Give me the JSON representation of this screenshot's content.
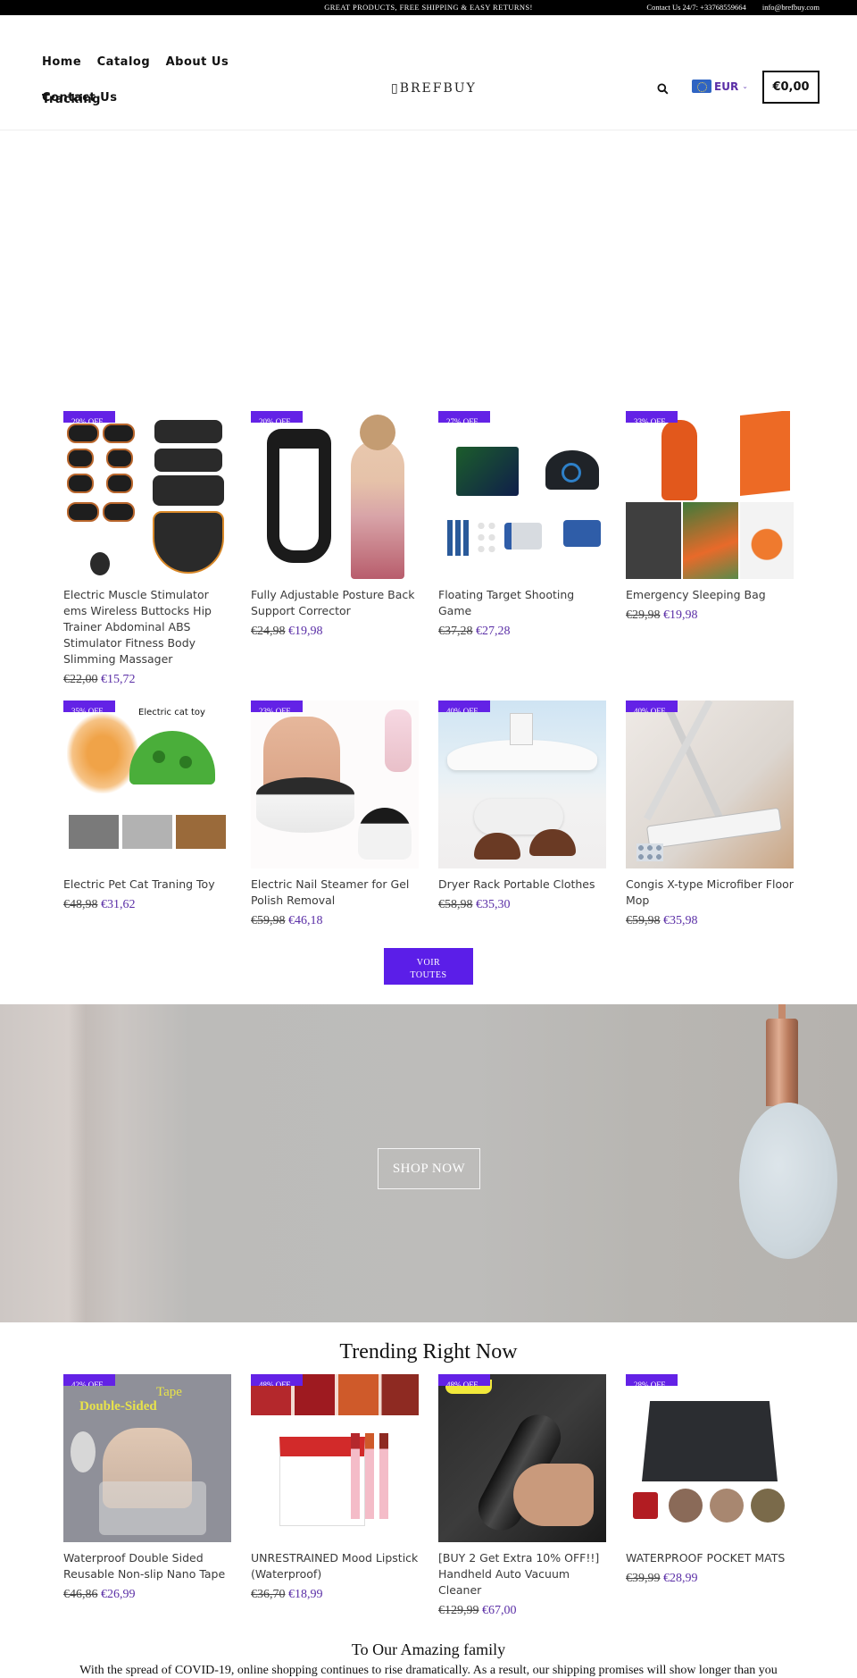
{
  "announcement": {
    "message": "GREAT PRODUCTS, FREE SHIPPING & EASY RETURNS!",
    "contact_phone": "Contact Us 24/7: +33768559664",
    "contact_email": "info@brefbuy.com"
  },
  "header": {
    "nav": [
      "Home",
      "Catalog",
      "About Us",
      "Contact Us",
      "Tracking"
    ],
    "logo": "▯BREFBUY",
    "currency": "EUR",
    "cart_total": "€0,00"
  },
  "featured": {
    "products": [
      {
        "badge": "29% OFF",
        "title": "Electric Muscle Stimulator ems Wireless Buttocks Hip Trainer Abdominal ABS Stimulator Fitness Body Slimming Massager",
        "old_price": "€22,00",
        "price": "€15,72",
        "image": "ems-muscle-stimulator"
      },
      {
        "badge": "20% OFF",
        "title": "Fully Adjustable Posture Back Support Corrector",
        "old_price": "€24,98",
        "price": "€19,98",
        "image": "posture-corrector"
      },
      {
        "badge": "27% OFF",
        "title": "Floating Target Shooting Game",
        "old_price": "€37,28",
        "price": "€27,28",
        "image": "floating-target-game"
      },
      {
        "badge": "33% OFF",
        "title": "Emergency Sleeping Bag",
        "old_price": "€29,98",
        "price": "€19,98",
        "image": "emergency-sleeping-bag"
      },
      {
        "badge": "35% OFF",
        "title": "Electric Pet Cat Traning Toy",
        "old_price": "€48,98",
        "price": "€31,62",
        "image": "electric-cat-toy",
        "image_caption": "Electric cat toy"
      },
      {
        "badge": "23% OFF",
        "title": "Electric Nail Steamer for Gel Polish Removal",
        "old_price": "€59,98",
        "price": "€46,18",
        "image": "nail-steamer"
      },
      {
        "badge": "40% OFF",
        "title": "Dryer Rack Portable Clothes",
        "old_price": "€58,98",
        "price": "€35,30",
        "image": "dryer-rack"
      },
      {
        "badge": "40% OFF",
        "title": "Congis X-type Microfiber Floor Mop",
        "old_price": "€59,98",
        "price": "€35,98",
        "image": "floor-mop"
      }
    ],
    "view_all_label": "VOIR TOUTES"
  },
  "hero": {
    "cta_label": "SHOP NOW"
  },
  "trending": {
    "title": "Trending Right Now",
    "products": [
      {
        "badge": "42% OFF",
        "title": "Waterproof Double Sided Reusable Non-slip Nano Tape",
        "old_price": "€46,86",
        "price": "€26,99",
        "image": "nano-tape",
        "image_caption_1": "Tape",
        "image_caption_2": "Double-Sided"
      },
      {
        "badge": "48% OFF",
        "title": "UNRESTRAINED Mood Lipstick (Waterproof)",
        "old_price": "€36,70",
        "price": "€18,99",
        "image": "mood-lipstick"
      },
      {
        "badge": "48% OFF",
        "title": "[BUY 2 Get Extra 10% OFF!!] Handheld Auto Vacuum Cleaner",
        "old_price": "€129,99",
        "price": "€67,00",
        "image": "handheld-vacuum"
      },
      {
        "badge": "28% OFF",
        "title": "WATERPROOF POCKET MATS",
        "old_price": "€39,99",
        "price": "€28,99",
        "image": "pocket-mat"
      }
    ]
  },
  "family": {
    "title": "To Our Amazing family",
    "text": "With the spread of COVID-19, online shopping continues to rise dramatically. As a result, our shipping promises will show longer than you"
  },
  "colors": {
    "accent": "#6322e6",
    "button": "#5b1ee8",
    "price": "#5a2ea6",
    "topbar": "#000000"
  }
}
